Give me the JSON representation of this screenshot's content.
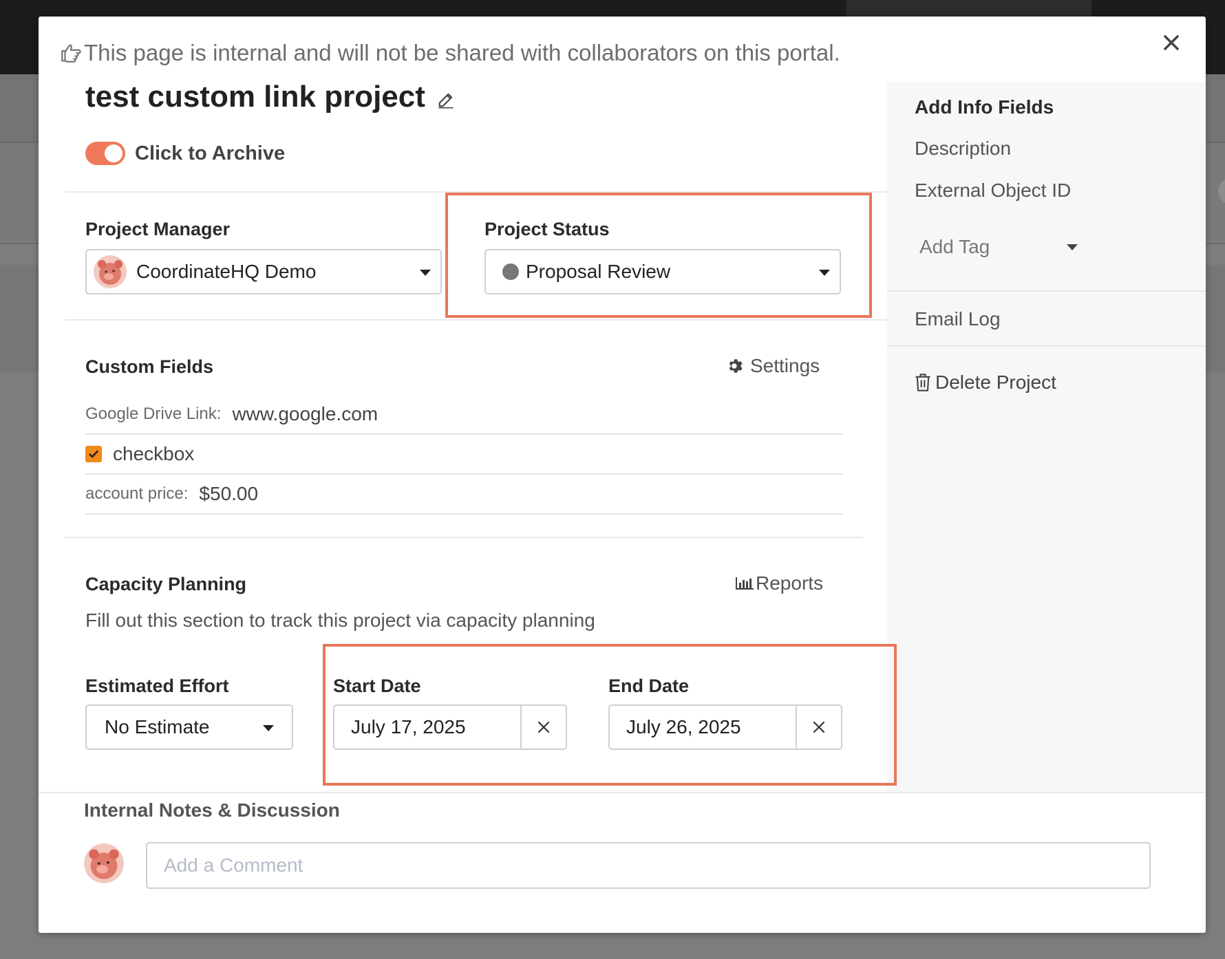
{
  "notice": "This page is internal and will not be shared with collaborators on this portal.",
  "project": {
    "title": "test custom link project",
    "archive_label": "Click to Archive"
  },
  "manager": {
    "label": "Project Manager",
    "value": "CoordinateHQ Demo"
  },
  "status": {
    "label": "Project Status",
    "value": "Proposal Review",
    "dot_color": "#777777"
  },
  "custom_fields": {
    "title": "Custom Fields",
    "settings_label": "Settings",
    "link_label": "Google Drive Link:",
    "link_value": "www.google.com",
    "checkbox_label": "checkbox",
    "price_label": "account price:",
    "price_value": "$50.00"
  },
  "capacity": {
    "title": "Capacity Planning",
    "reports_label": "Reports",
    "subtext": "Fill out this section to track this project via capacity planning",
    "effort_label": "Estimated Effort",
    "effort_value": "No Estimate",
    "start_label": "Start Date",
    "start_value": "July 17, 2025",
    "end_label": "End Date",
    "end_value": "July 26, 2025"
  },
  "sidebar": {
    "title": "Add Info Fields",
    "description": "Description",
    "external_id": "External Object ID",
    "add_tag": "Add Tag",
    "email_log": "Email Log",
    "delete": "Delete Project"
  },
  "notes": {
    "title": "Internal Notes & Discussion",
    "placeholder": "Add a Comment"
  },
  "colors": {
    "accent": "#ef7a5a",
    "highlight": "#e8775a",
    "checkbox": "#f08a1a"
  }
}
